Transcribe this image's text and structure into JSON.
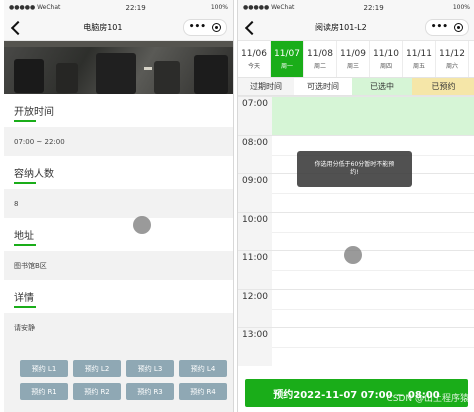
{
  "left": {
    "status": {
      "signal": "●●●●● WeChat",
      "time": "22:19",
      "battery": "100%"
    },
    "nav": {
      "title": "电脑房101"
    },
    "sections": [
      {
        "title": "开放时间",
        "value": "07:00 ~ 22:00"
      },
      {
        "title": "容纳人数",
        "value": "8"
      },
      {
        "title": "地址",
        "value": "图书馆B区"
      },
      {
        "title": "详情",
        "value": "请安静"
      }
    ],
    "book_buttons": [
      "预约 L1",
      "预约 L2",
      "预约 L3",
      "预约 L4",
      "预约 R1",
      "预约 R2",
      "预约 R3",
      "预约 R4"
    ]
  },
  "right": {
    "status": {
      "signal": "●●●●● WeChat",
      "time": "22:19",
      "battery": "100%"
    },
    "nav": {
      "title": "阅读房101-L2"
    },
    "days": [
      {
        "date": "11/06",
        "weekday": "今天",
        "selected": false
      },
      {
        "date": "11/07",
        "weekday": "周一",
        "selected": true
      },
      {
        "date": "11/08",
        "weekday": "周二",
        "selected": false
      },
      {
        "date": "11/09",
        "weekday": "周三",
        "selected": false
      },
      {
        "date": "11/10",
        "weekday": "周四",
        "selected": false
      },
      {
        "date": "11/11",
        "weekday": "周五",
        "selected": false
      },
      {
        "date": "11/12",
        "weekday": "周六",
        "selected": false
      }
    ],
    "legend": [
      {
        "label": "过期时间",
        "color": "#f4f4f4"
      },
      {
        "label": "可选时间",
        "color": "#ffffff"
      },
      {
        "label": "已选中",
        "color": "#d6f5d6"
      },
      {
        "label": "已预约",
        "color": "#f5e6a8"
      }
    ],
    "times": [
      "07:00",
      "08:00",
      "09:00",
      "10:00",
      "11:00",
      "12:00",
      "13:00"
    ],
    "toast": "你选用分低于60分暂时不能预约!",
    "book_bar": "预约2022-11-07 07:00 ~ 08:00",
    "watermark": "CSDN @山上程序猿"
  }
}
